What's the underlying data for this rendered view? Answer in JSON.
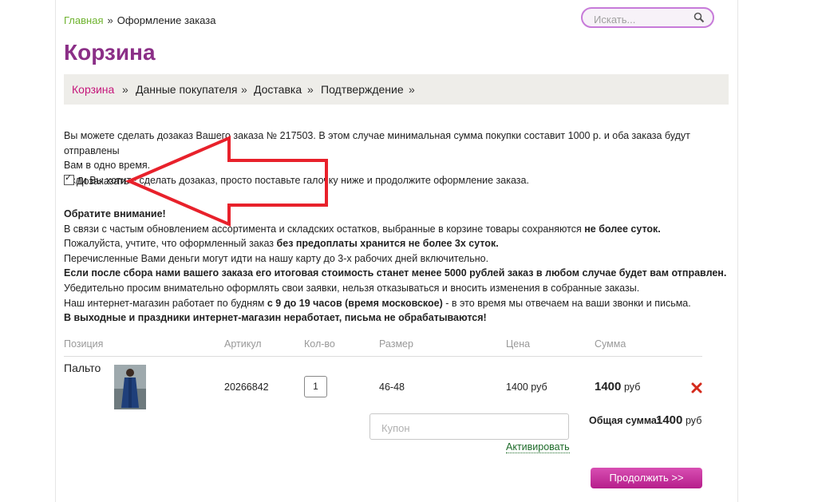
{
  "breadcrumb": {
    "home": "Главная",
    "separator": "»",
    "current": "Оформление заказа"
  },
  "search": {
    "placeholder": "Искать..."
  },
  "page_title": "Корзина",
  "steps": [
    {
      "label": "Корзина",
      "active": true
    },
    {
      "label": "Данные покупателя",
      "active": false
    },
    {
      "label": "Доставка",
      "active": false
    },
    {
      "label": "Подтверждение",
      "active": false
    }
  ],
  "step_separator": "»",
  "info": {
    "line1": "Вы можете сделать дозаказ Вашего заказа № 217503. В этом случае минимальная сумма покупки составит 1000 р. и оба заказа будут отправлены",
    "line2": "Вам в одно время.",
    "line3": "Если Вы хотите сделать дозаказ, просто поставьте галочку ниже и продолжите оформление заказа.",
    "checkbox_label": "Дозаказать",
    "checkbox_checked": true
  },
  "notice": {
    "heading": "Обратите внимание!",
    "l1a": "В связи с частым обновлением ассортимента и складских остатков, выбранные в корзине товары сохраняются ",
    "l1b": "не более суток.",
    "l2a": "Пожалуйста, учтите, что оформленный заказ ",
    "l2b": "без предоплаты хранится не более 3х суток.",
    "l3": "Перечисленные Вами деньги могут идти на нашу карту до 3-х рабочих дней включительно.",
    "l4": "Если после сбора нами вашего заказа его итоговая стоимость станет менее 5000 рублей заказ в любом случае будет вам отправлен.",
    "l5": "Убедительно просим внимательно оформлять свои заявки, нельзя отказываться и вносить изменения в собранные заказы.",
    "l6a": "Наш интернет-магазин работает по будням ",
    "l6b": "с 9 до 19 часов (время московское)",
    "l6c": " - в это время мы отвечаем на ваши звонки и письма.",
    "l7": "В выходные и праздники интернет-магазин неработает, письма не обрабатываются!"
  },
  "table": {
    "headers": [
      "Позиция",
      "Артикул",
      "Кол-во",
      "Размер",
      "Цена",
      "Сумма"
    ],
    "item": {
      "name": "Пальто",
      "article": "20266842",
      "qty": "1",
      "size": "46-48",
      "price": "1400 руб",
      "sum_value": "1400",
      "sum_unit": "руб"
    }
  },
  "coupon": {
    "placeholder": "Купон",
    "activate": "Активировать"
  },
  "total": {
    "label": "Общая сумма:",
    "value": "1400",
    "unit": "руб"
  },
  "continue_label": "Продолжить >>",
  "colors": {
    "accent": "#8b2f87",
    "active_step": "#c5177b",
    "home_link": "#6fb32f",
    "arrow": "#e8212b"
  }
}
